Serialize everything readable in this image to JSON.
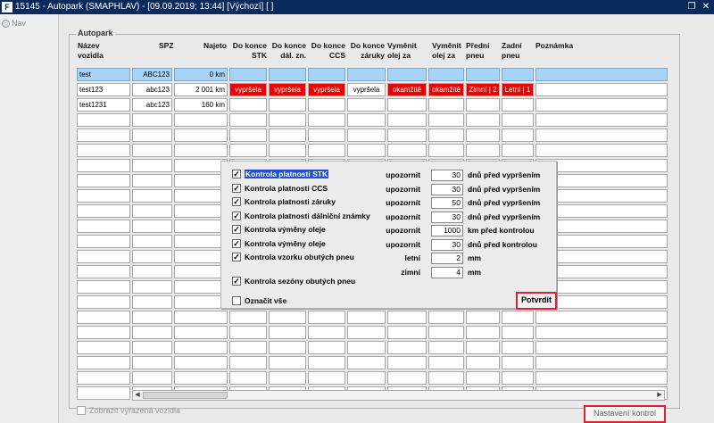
{
  "window": {
    "title": "15145 - Autopark (SMAPHLAV) - [09.09.2019; 13:44]  [Výchozí]  [ ]",
    "icon_text": "F"
  },
  "nav": {
    "label": "Nav"
  },
  "group": {
    "title": "Autopark"
  },
  "table": {
    "headers": {
      "name": [
        "Název",
        "vozidla"
      ],
      "spz": "SPZ",
      "km": "Najeto",
      "stk": [
        "Do konce",
        "STK"
      ],
      "dal": [
        "Do konce",
        "dál. zn."
      ],
      "ccs": [
        "Do konce",
        "CCS"
      ],
      "zaruka": [
        "Do konce",
        "záruky"
      ],
      "olej": [
        "Vyměnit",
        "olej za"
      ],
      "kontrola": [
        "Vyměnit",
        "olej za"
      ],
      "predni": [
        "Přední",
        "pneu"
      ],
      "zadni": [
        "Zadní",
        "pneu"
      ],
      "poznamka": "Poznámka"
    },
    "rows": [
      {
        "name": "test",
        "spz": "ABC123",
        "km": "0 km",
        "stk": "",
        "dal": "",
        "ccs": "",
        "zaruka": "",
        "olej": "",
        "kontrola": "",
        "predni": "",
        "zadni": "",
        "poznamka": ""
      },
      {
        "name": "test123",
        "spz": "abc123",
        "km": "2 001 km",
        "stk": "vypršela",
        "dal": "vypršela",
        "ccs": "vypršela",
        "zaruka": "vypršela",
        "olej": "okamžitě",
        "kontrola": "okamžitě",
        "predni": "Zimní | 2",
        "zadni": "Letní | 1",
        "poznamka": ""
      },
      {
        "name": "test1231",
        "spz": "abc123",
        "km": "160 km",
        "stk": "",
        "dal": "",
        "ccs": "",
        "zaruka": "",
        "olej": "",
        "kontrola": "",
        "predni": "",
        "zadni": "",
        "poznamka": ""
      }
    ],
    "empty_row_count": 19
  },
  "footer": {
    "show_removed_label": "Zobrazit vyřazená vozidla",
    "settings_button": "Nastavení kontrol"
  },
  "dialog": {
    "items": [
      {
        "label": "Kontrola platnosti STK",
        "checked": true,
        "selected": true,
        "mode": "upozornit",
        "value": "30",
        "unit": "dnů před vypršením"
      },
      {
        "label": "Kontrola platnosti CCS",
        "checked": true,
        "mode": "upozornit",
        "value": "30",
        "unit": "dnů před vypršením"
      },
      {
        "label": "Kontrola platnosti záruky",
        "checked": true,
        "mode": "upozornit",
        "value": "50",
        "unit": "dnů před vypršením"
      },
      {
        "label": "Kontrola platnosti dálniční známky",
        "checked": true,
        "mode": "upozornit",
        "value": "30",
        "unit": "dnů před vypršením"
      },
      {
        "label": "Kontrola výměny oleje",
        "checked": true,
        "mode": "upozornit",
        "value": "1000",
        "unit": "km před kontrolou"
      },
      {
        "label": "Kontrola výměny oleje",
        "checked": true,
        "mode": "upozornit",
        "value": "30",
        "unit": "dnů před kontrolou"
      },
      {
        "label": "Kontrola vzorku obutých pneu",
        "checked": true,
        "mode": "letní",
        "value": "2",
        "unit": "mm"
      }
    ],
    "winter": {
      "mode": "zimní",
      "value": "4",
      "unit": "mm"
    },
    "season_check": {
      "label": "Kontrola sezóny obutých pneu",
      "checked": true
    },
    "select_all": {
      "label": "Označit vše",
      "checked": false
    },
    "confirm_button": "Potvrdit"
  },
  "colors": {
    "alert": "#ee0000",
    "selection": "#a7d3f7",
    "highlight": "#e0202a",
    "titlebar": "#0a2a5c"
  },
  "icons": {
    "restore": "restore-icon",
    "close": "close-icon",
    "left": "arrow-left-icon",
    "right": "arrow-right-icon"
  }
}
